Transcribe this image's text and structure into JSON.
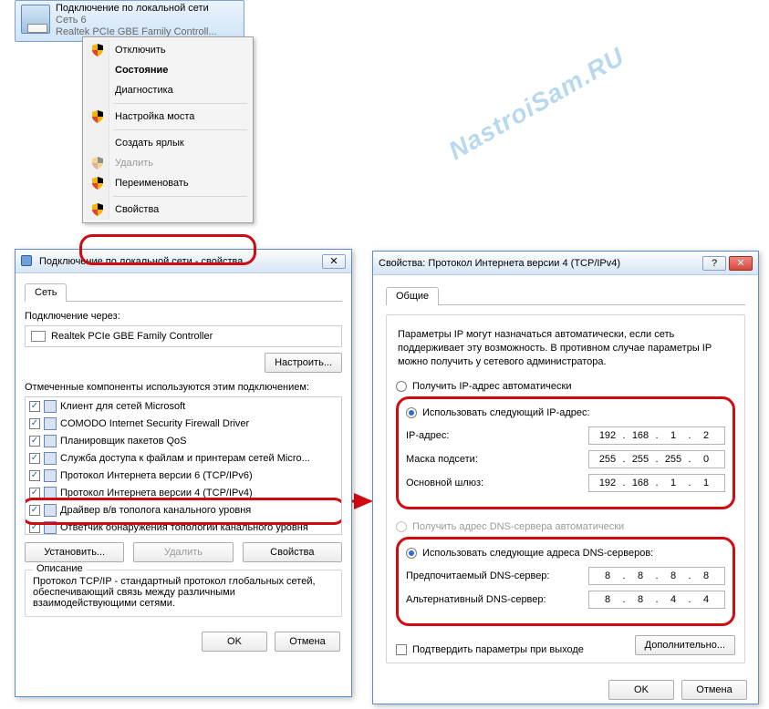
{
  "adapter": {
    "title": "Подключение по локальной сети",
    "network": "Сеть 6",
    "device": "Realtek PCIe GBE Family Controll..."
  },
  "context_menu": {
    "items": [
      {
        "label": "Отключить",
        "shield": true,
        "disabled": false
      },
      {
        "label": "Состояние",
        "shield": false,
        "disabled": false,
        "bold": true
      },
      {
        "label": "Диагностика",
        "shield": false,
        "disabled": false
      }
    ],
    "items2": [
      {
        "label": "Настройка моста",
        "shield": true,
        "disabled": false
      }
    ],
    "items3": [
      {
        "label": "Создать ярлык",
        "shield": false,
        "disabled": false
      },
      {
        "label": "Удалить",
        "shield": true,
        "disabled": true
      },
      {
        "label": "Переименовать",
        "shield": true,
        "disabled": false
      }
    ],
    "items4": [
      {
        "label": "Свойства",
        "shield": true,
        "disabled": false
      }
    ]
  },
  "dlg1": {
    "title": "Подключение по локальной сети - свойства",
    "tab": "Сеть",
    "connect_via": "Подключение через:",
    "adapter": "Realtek PCIe GBE Family Controller",
    "configure": "Настроить...",
    "components_label": "Отмеченные компоненты используются этим подключением:",
    "components": [
      "Клиент для сетей Microsoft",
      "COMODO Internet Security Firewall Driver",
      "Планировщик пакетов QoS",
      "Служба доступа к файлам и принтерам сетей Micro...",
      "Протокол Интернета версии 6 (TCP/IPv6)",
      "Протокол Интернета версии 4 (TCP/IPv4)",
      "Драйвер в/в тополога канального уровня",
      "Ответчик обнаружения топологии канального уровня"
    ],
    "install": "Установить...",
    "remove": "Удалить",
    "properties": "Свойства",
    "desc_caption": "Описание",
    "description": "Протокол TCP/IP - стандартный протокол глобальных сетей, обеспечивающий связь между различными взаимодействующими сетями.",
    "ok": "OK",
    "cancel": "Отмена"
  },
  "dlg2": {
    "title": "Свойства: Протокол Интернета версии 4 (TCP/IPv4)",
    "tab": "Общие",
    "intro": "Параметры IP могут назначаться автоматически, если сеть поддерживает эту возможность. В противном случае параметры IP можно получить у сетевого администратора.",
    "ip_auto": "Получить IP-адрес автоматически",
    "ip_manual": "Использовать следующий IP-адрес:",
    "ip_label": "IP-адрес:",
    "mask_label": "Маска подсети:",
    "gw_label": "Основной шлюз:",
    "ip": [
      "192",
      "168",
      "1",
      "2"
    ],
    "mask": [
      "255",
      "255",
      "255",
      "0"
    ],
    "gw": [
      "192",
      "168",
      "1",
      "1"
    ],
    "dns_auto": "Получить адрес DNS-сервера автоматически",
    "dns_manual": "Использовать следующие адреса DNS-серверов:",
    "dns1_label": "Предпочитаемый DNS-сервер:",
    "dns2_label": "Альтернативный DNS-сервер:",
    "dns1": [
      "8",
      "8",
      "8",
      "8"
    ],
    "dns2": [
      "8",
      "8",
      "4",
      "4"
    ],
    "confirm": "Подтвердить параметры при выходе",
    "advanced": "Дополнительно...",
    "ok": "OK",
    "cancel": "Отмена"
  },
  "watermark": "NastroiSam.RU"
}
